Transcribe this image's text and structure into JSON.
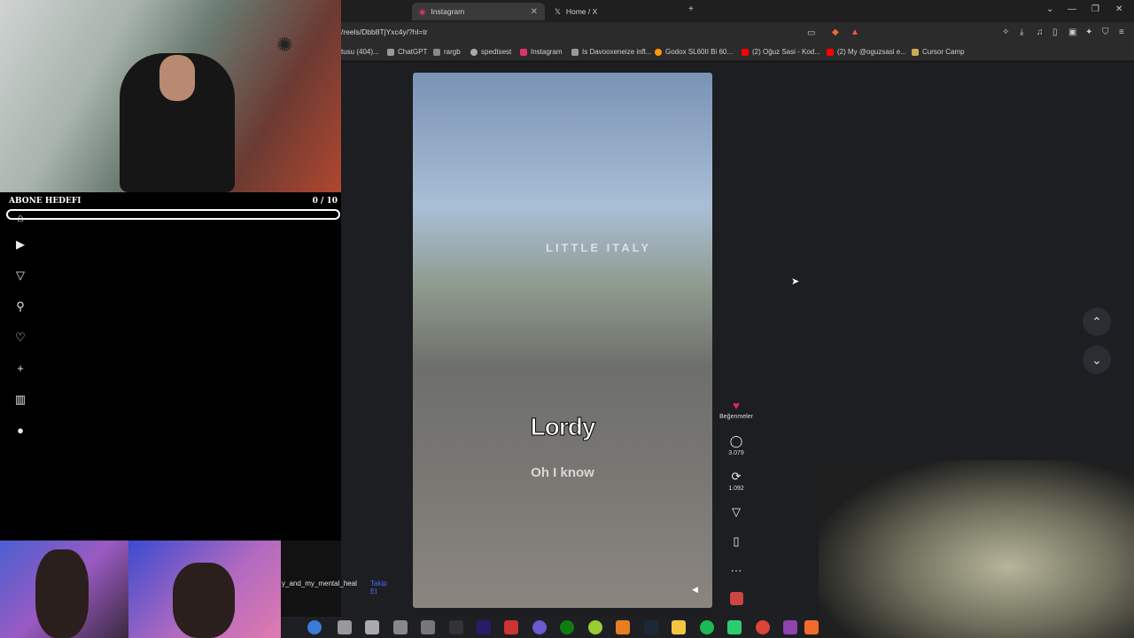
{
  "browser": {
    "tabs": [
      {
        "label": "Instagram",
        "active": true
      },
      {
        "label": "Home / X",
        "active": false
      }
    ],
    "url": "/reels/Dbb8TjYxc4y/?hl=tr",
    "bookmarks": [
      "tusu (404)...",
      "ChatGPT",
      "rargb",
      "spedtsest",
      "Instagram",
      "Is Davooxeneize infl...",
      "Godox SL60II Bi 60...",
      "(2) Oğuz Sasi - Kod...",
      "(2) My @oguzsasi e...",
      "Cursor Camp"
    ]
  },
  "overlay": {
    "goal_label": "ABONE HEDEFI",
    "goal_count": "0 / 10",
    "goal_progress": 0
  },
  "reel": {
    "caption_main": "Lordy",
    "caption_sub": "Oh I know",
    "sign_text": "LITTLE ITALY",
    "likes_label": "Beğenmeler",
    "comments_count": "3.079",
    "reposts_count": "1.092",
    "username": "y_and_my_mental_heal",
    "follow_label": "Takip Et"
  },
  "sidebar_icons": [
    "home-icon",
    "reels-icon",
    "send-icon",
    "search-icon",
    "heart-icon",
    "create-icon",
    "insights-icon",
    "profile-icon"
  ],
  "colors": {
    "accent": "#4a6cf7",
    "like": "#e0245e",
    "bg": "#1c1e22"
  }
}
